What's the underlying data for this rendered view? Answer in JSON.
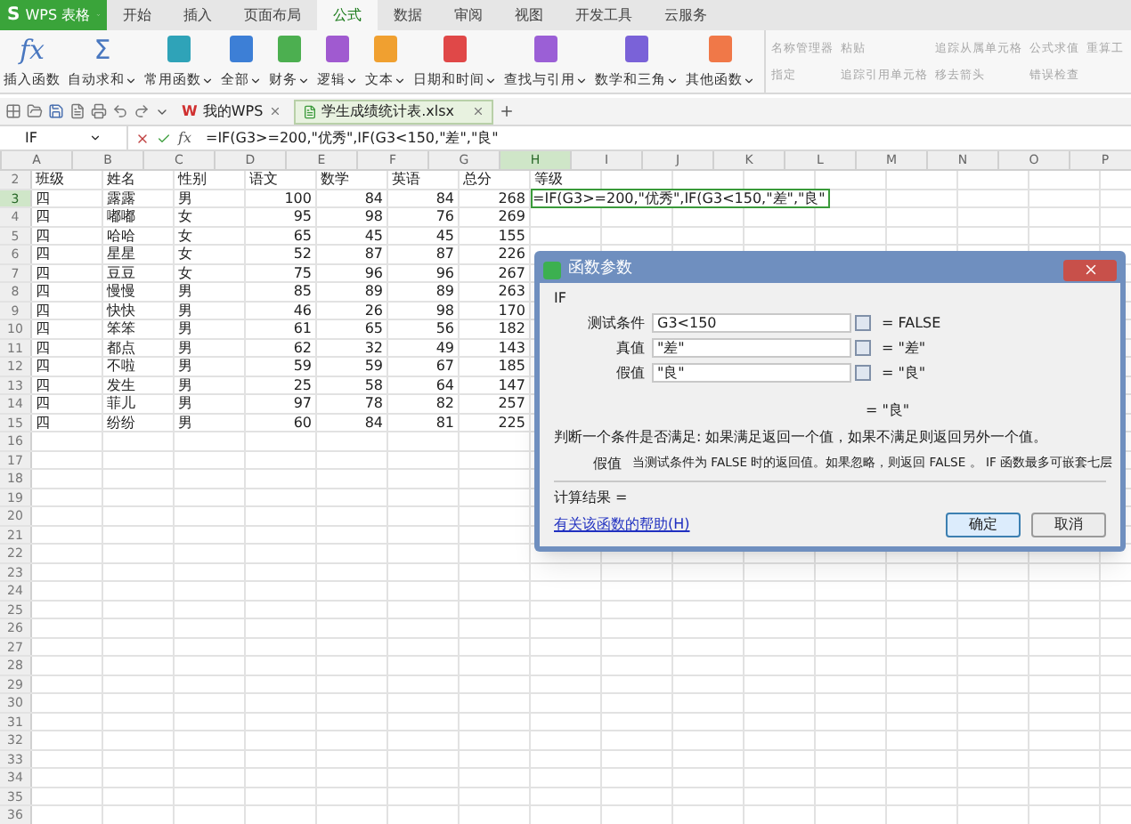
{
  "app_button": {
    "logo": "S",
    "label": "WPS 表格"
  },
  "menu_tabs": [
    {
      "label": "开始",
      "selected": false
    },
    {
      "label": "插入",
      "selected": false
    },
    {
      "label": "页面布局",
      "selected": false
    },
    {
      "label": "公式",
      "selected": true
    },
    {
      "label": "数据",
      "selected": false
    },
    {
      "label": "审阅",
      "selected": false
    },
    {
      "label": "视图",
      "selected": false
    },
    {
      "label": "开发工具",
      "selected": false
    },
    {
      "label": "云服务",
      "selected": false
    }
  ],
  "ribbon": [
    {
      "kind": "glyph",
      "glyph": "fx",
      "label": "插入函数",
      "dropdown": false
    },
    {
      "kind": "glyph",
      "glyph": "Σ",
      "label": "自动求和",
      "dropdown": true
    },
    {
      "kind": "square",
      "color": "#2fa3b8",
      "label": "常用函数",
      "dropdown": true
    },
    {
      "kind": "square",
      "color": "#3d7fd6",
      "label": "全部",
      "dropdown": true
    },
    {
      "kind": "square",
      "color": "#4caf50",
      "label": "财务",
      "dropdown": true
    },
    {
      "kind": "square",
      "color": "#a05ad0",
      "label": "逻辑",
      "dropdown": true
    },
    {
      "kind": "square",
      "color": "#f0a030",
      "label": "文本",
      "dropdown": true
    },
    {
      "kind": "square",
      "color": "#e04848",
      "label": "日期和时间",
      "dropdown": true
    },
    {
      "kind": "square",
      "color": "#9b5fd6",
      "label": "查找与引用",
      "dropdown": true
    },
    {
      "kind": "square",
      "color": "#7a62d8",
      "label": "数学和三角",
      "dropdown": true
    },
    {
      "kind": "square",
      "color": "#f07848",
      "label": "其他函数",
      "dropdown": true
    }
  ],
  "ribbon_tools": [
    {
      "label": "名称管理器",
      "disabled": true
    },
    {
      "label": "指定",
      "disabled": true
    },
    {
      "label": "粘贴",
      "disabled": true
    },
    {
      "label": "追踪引用单元格",
      "disabled": true
    },
    {
      "label": "追踪从属单元格",
      "disabled": true
    },
    {
      "label": "移去箭头",
      "disabled": true
    },
    {
      "label": "公式求值",
      "disabled": true
    },
    {
      "label": "错误检查",
      "disabled": true
    },
    {
      "label": "重算工",
      "disabled": true
    }
  ],
  "doc_tabs": [
    {
      "icon_letter": "W",
      "label": "我的WPS",
      "selected": false
    },
    {
      "label": "学生成绩统计表.xlsx",
      "selected": true
    }
  ],
  "formula_bar": {
    "name_box": "IF",
    "function_label": "fx",
    "formula": "=IF(G3>=200,\"优秀\",IF(G3<150,\"差\",\"良\""
  },
  "columns": [
    {
      "label": "A",
      "selected": false
    },
    {
      "label": "B",
      "selected": false
    },
    {
      "label": "C",
      "selected": false
    },
    {
      "label": "D",
      "selected": false
    },
    {
      "label": "E",
      "selected": false
    },
    {
      "label": "F",
      "selected": false
    },
    {
      "label": "G",
      "selected": false
    },
    {
      "label": "H",
      "selected": true
    },
    {
      "label": "I",
      "selected": false
    },
    {
      "label": "J",
      "selected": false
    },
    {
      "label": "K",
      "selected": false
    },
    {
      "label": "L",
      "selected": false
    },
    {
      "label": "M",
      "selected": false
    },
    {
      "label": "N",
      "selected": false
    },
    {
      "label": "O",
      "selected": false
    },
    {
      "label": "P",
      "selected": false
    }
  ],
  "rows": [
    {
      "number": "2",
      "selected": false,
      "kind": "header",
      "cells": [
        "班级",
        "姓名",
        "性别",
        "语文",
        "数学",
        "英语",
        "总分",
        "等级"
      ]
    },
    {
      "number": "3",
      "selected": true,
      "kind": "data",
      "cells": [
        "四",
        "露露",
        "男",
        "100",
        "84",
        "84",
        "268"
      ],
      "editor": "=IF(G3>=200,\"优秀\",IF(G3<150,\"差\",\"良\""
    },
    {
      "number": "4",
      "selected": false,
      "kind": "data",
      "cells": [
        "四",
        "嘟嘟",
        "女",
        "95",
        "98",
        "76",
        "269"
      ]
    },
    {
      "number": "5",
      "selected": false,
      "kind": "data",
      "cells": [
        "四",
        "哈哈",
        "女",
        "65",
        "45",
        "45",
        "155"
      ]
    },
    {
      "number": "6",
      "selected": false,
      "kind": "data",
      "cells": [
        "四",
        "星星",
        "女",
        "52",
        "87",
        "87",
        "226"
      ]
    },
    {
      "number": "7",
      "selected": false,
      "kind": "data",
      "cells": [
        "四",
        "豆豆",
        "女",
        "75",
        "96",
        "96",
        "267"
      ]
    },
    {
      "number": "8",
      "selected": false,
      "kind": "data",
      "cells": [
        "四",
        "慢慢",
        "男",
        "85",
        "89",
        "89",
        "263"
      ]
    },
    {
      "number": "9",
      "selected": false,
      "kind": "data",
      "cells": [
        "四",
        "快快",
        "男",
        "46",
        "26",
        "98",
        "170"
      ]
    },
    {
      "number": "10",
      "selected": false,
      "kind": "data",
      "cells": [
        "四",
        "笨笨",
        "男",
        "61",
        "65",
        "56",
        "182"
      ]
    },
    {
      "number": "11",
      "selected": false,
      "kind": "data",
      "cells": [
        "四",
        "都点",
        "男",
        "62",
        "32",
        "49",
        "143"
      ]
    },
    {
      "number": "12",
      "selected": false,
      "kind": "data",
      "cells": [
        "四",
        "不啦",
        "男",
        "59",
        "59",
        "67",
        "185"
      ]
    },
    {
      "number": "13",
      "selected": false,
      "kind": "data",
      "cells": [
        "四",
        "发生",
        "男",
        "25",
        "58",
        "64",
        "147"
      ]
    },
    {
      "number": "14",
      "selected": false,
      "kind": "data",
      "cells": [
        "四",
        "菲儿",
        "男",
        "97",
        "78",
        "82",
        "257"
      ]
    },
    {
      "number": "15",
      "selected": false,
      "kind": "data",
      "cells": [
        "四",
        "纷纷",
        "男",
        "60",
        "84",
        "81",
        "225"
      ]
    },
    {
      "number": "16",
      "selected": false,
      "kind": "empty"
    },
    {
      "number": "17",
      "selected": false,
      "kind": "empty"
    },
    {
      "number": "18",
      "selected": false,
      "kind": "empty"
    },
    {
      "number": "19",
      "selected": false,
      "kind": "empty"
    },
    {
      "number": "20",
      "selected": false,
      "kind": "empty"
    },
    {
      "number": "21",
      "selected": false,
      "kind": "empty"
    },
    {
      "number": "22",
      "selected": false,
      "kind": "empty"
    },
    {
      "number": "23",
      "selected": false,
      "kind": "empty"
    },
    {
      "number": "24",
      "selected": false,
      "kind": "empty"
    },
    {
      "number": "25",
      "selected": false,
      "kind": "empty"
    },
    {
      "number": "26",
      "selected": false,
      "kind": "empty"
    },
    {
      "number": "27",
      "selected": false,
      "kind": "empty"
    },
    {
      "number": "28",
      "selected": false,
      "kind": "empty"
    },
    {
      "number": "29",
      "selected": false,
      "kind": "empty"
    },
    {
      "number": "30",
      "selected": false,
      "kind": "empty"
    },
    {
      "number": "31",
      "selected": false,
      "kind": "empty"
    },
    {
      "number": "32",
      "selected": false,
      "kind": "empty"
    },
    {
      "number": "33",
      "selected": false,
      "kind": "empty"
    },
    {
      "number": "34",
      "selected": false,
      "kind": "empty"
    },
    {
      "number": "35",
      "selected": false,
      "kind": "empty"
    },
    {
      "number": "36",
      "selected": false,
      "kind": "empty"
    }
  ],
  "dialog": {
    "title": "函数参数",
    "function_name": "IF",
    "arguments": [
      {
        "label": "测试条件",
        "value": "G3<150",
        "result": "= FALSE"
      },
      {
        "label": "真值",
        "value": "\"差\"",
        "result": "= \"差\""
      },
      {
        "label": "假值",
        "value": "\"良\"",
        "result": "= \"良\""
      }
    ],
    "overall_result": "= \"良\"",
    "description": "判断一个条件是否满足: 如果满足返回一个值，如果不满足则返回另外一个值。",
    "argument_help_label": "假值",
    "argument_help": "当测试条件为 FALSE 时的返回值。如果忽略，则返回 FALSE 。 IF 函数最多可嵌套七层",
    "calc_result": "计算结果 =",
    "help_link": "有关该函数的帮助(H)",
    "buttons": [
      {
        "label": "确定",
        "selected": true
      },
      {
        "label": "取消",
        "selected": false
      }
    ]
  }
}
